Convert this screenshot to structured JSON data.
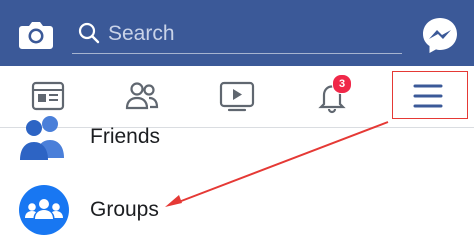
{
  "header": {
    "search_placeholder": "Search",
    "icons": [
      "camera-icon",
      "search-icon",
      "messenger-icon"
    ],
    "brand_color": "#3b5998"
  },
  "navbar": {
    "items": [
      {
        "icon": "news-feed-icon"
      },
      {
        "icon": "friends-icon"
      },
      {
        "icon": "watch-icon"
      },
      {
        "icon": "notifications-icon",
        "badge": "3"
      },
      {
        "icon": "menu-icon"
      }
    ],
    "active_color": "#3b5998"
  },
  "menu": {
    "items": [
      {
        "label": "Friends",
        "icon": "friends-icon"
      },
      {
        "label": "Groups",
        "icon": "groups-icon"
      }
    ]
  },
  "annotation": {
    "color": "#e53935"
  }
}
